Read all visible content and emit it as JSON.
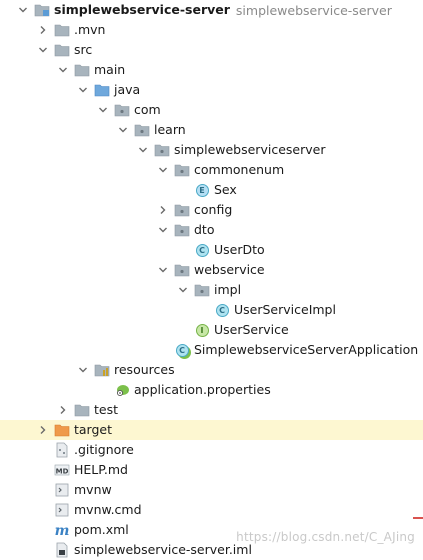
{
  "tree": {
    "rows": [
      {
        "label": "simplewebservice-server",
        "path": "simplewebservice-server",
        "icon": "module-folder-icon",
        "arrow": "down",
        "indent": 0,
        "bold": true
      },
      {
        "label": ".mvn",
        "icon": "folder-icon",
        "arrow": "right",
        "indent": 1
      },
      {
        "label": "src",
        "icon": "folder-icon",
        "arrow": "down",
        "indent": 1
      },
      {
        "label": "main",
        "icon": "folder-icon",
        "arrow": "down",
        "indent": 2
      },
      {
        "label": "java",
        "icon": "source-folder-icon",
        "arrow": "down",
        "indent": 3
      },
      {
        "label": "com",
        "icon": "package-icon",
        "arrow": "down",
        "indent": 4
      },
      {
        "label": "learn",
        "icon": "package-icon",
        "arrow": "down",
        "indent": 5
      },
      {
        "label": "simplewebserviceserver",
        "icon": "package-icon",
        "arrow": "down",
        "indent": 6
      },
      {
        "label": "commonenum",
        "icon": "package-icon",
        "arrow": "down",
        "indent": 7
      },
      {
        "label": "Sex",
        "icon": "enum-icon",
        "arrow": "none",
        "indent": 8
      },
      {
        "label": "config",
        "icon": "package-icon",
        "arrow": "right",
        "indent": 7
      },
      {
        "label": "dto",
        "icon": "package-icon",
        "arrow": "down",
        "indent": 7
      },
      {
        "label": "UserDto",
        "icon": "class-icon",
        "arrow": "none",
        "indent": 8
      },
      {
        "label": "webservice",
        "icon": "package-icon",
        "arrow": "down",
        "indent": 7
      },
      {
        "label": "impl",
        "icon": "package-icon",
        "arrow": "down",
        "indent": 8
      },
      {
        "label": "UserServiceImpl",
        "icon": "class-icon",
        "arrow": "none",
        "indent": 9
      },
      {
        "label": "UserService",
        "icon": "interface-icon",
        "arrow": "none",
        "indent": 8
      },
      {
        "label": "SimplewebserviceServerApplication",
        "icon": "spring-class-icon",
        "arrow": "none",
        "indent": 7
      },
      {
        "label": "resources",
        "icon": "resources-folder-icon",
        "arrow": "down",
        "indent": 3
      },
      {
        "label": "application.properties",
        "icon": "properties-file-icon",
        "arrow": "none",
        "indent": 4
      },
      {
        "label": "test",
        "icon": "folder-icon",
        "arrow": "right",
        "indent": 2
      },
      {
        "label": "target",
        "icon": "excluded-folder-icon",
        "arrow": "right",
        "indent": 1,
        "selected": true
      },
      {
        "label": ".gitignore",
        "icon": "gitignore-file-icon",
        "arrow": "none",
        "indent": 1
      },
      {
        "label": "HELP.md",
        "icon": "markdown-file-icon",
        "arrow": "none",
        "indent": 1
      },
      {
        "label": "mvnw",
        "icon": "script-file-icon",
        "arrow": "none",
        "indent": 1
      },
      {
        "label": "mvnw.cmd",
        "icon": "script-file-icon",
        "arrow": "none",
        "indent": 1
      },
      {
        "label": "pom.xml",
        "icon": "maven-file-icon",
        "arrow": "none",
        "indent": 1
      },
      {
        "label": "simplewebservice-server.iml",
        "icon": "iml-file-icon",
        "arrow": "none",
        "indent": 1
      }
    ]
  },
  "watermark": "https://blog.csdn.net/C_AJing",
  "colors": {
    "selected_row": "#fdf7d1",
    "folder": "#9aa7b0",
    "source_folder": "#5b9bd5",
    "resources_folder": "#c9a227",
    "excluded_folder": "#e8873a"
  }
}
